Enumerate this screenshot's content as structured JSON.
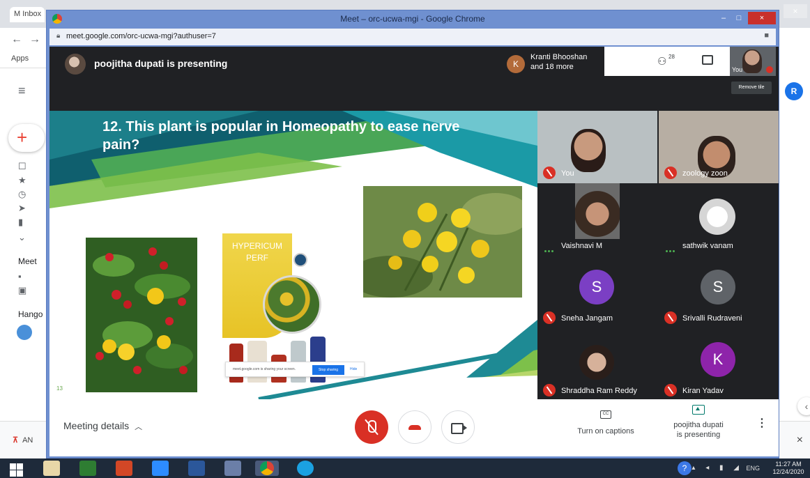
{
  "background": {
    "gmail_tab_label": "M Inbox",
    "apps_label": "Apps",
    "sidebar_meet_label": "Meet",
    "sidebar_hangouts_label": "Hango",
    "avatar_letter": "R",
    "download_label": "AN",
    "download_close": "×"
  },
  "window": {
    "title": "Meet – orc-ucwa-mgi - Google Chrome",
    "url": "meet.google.com/orc-ucwa-mgi?authuser=7",
    "minimize": "–",
    "maximize": "□",
    "close": "×"
  },
  "meet": {
    "presenting_banner": "poojitha dupati is presenting",
    "raised_avatar_letter": "K",
    "raised_text_line1": "Kranti Bhooshan",
    "raised_text_line2": "and 18 more",
    "people_count": "28",
    "self_label": "You",
    "remove_tile": "Remove tile"
  },
  "slide": {
    "title": "12. This plant is popular in Homeopathy to ease nerve pain?",
    "number": "13",
    "hypericum_title_line1": "HYPERICUM",
    "hypericum_title_line2": "PERF",
    "share_text": "meet.google.com is sharing your screen.",
    "stop_sharing": "Stop sharing",
    "hide": "Hide"
  },
  "participants": [
    {
      "name": "You",
      "muted": true
    },
    {
      "name": "zoology zoon",
      "muted": true
    },
    {
      "name": "Vaishnavi M",
      "muted": false
    },
    {
      "name": "sathwik vanam",
      "muted": false
    },
    {
      "name": "Sneha Jangam",
      "muted": true,
      "letter": "S",
      "color": "#8e44ad"
    },
    {
      "name": "Srivalli Rudraveni",
      "muted": true,
      "letter": "S",
      "color": "#5f6368"
    },
    {
      "name": "Shraddha Ram Reddy",
      "muted": true
    },
    {
      "name": "Kiran Yadav",
      "muted": true,
      "letter": "K",
      "color": "#8e24aa"
    }
  ],
  "bottom_bar": {
    "meeting_details": "Meeting details",
    "captions_icon": "CC",
    "captions_label": "Turn on captions",
    "presenting_line1": "poojitha dupati",
    "presenting_line2": "is presenting",
    "more": "⋮"
  },
  "taskbar": {
    "lang": "ENG",
    "time": "11:27 AM",
    "date": "12/24/2020"
  }
}
